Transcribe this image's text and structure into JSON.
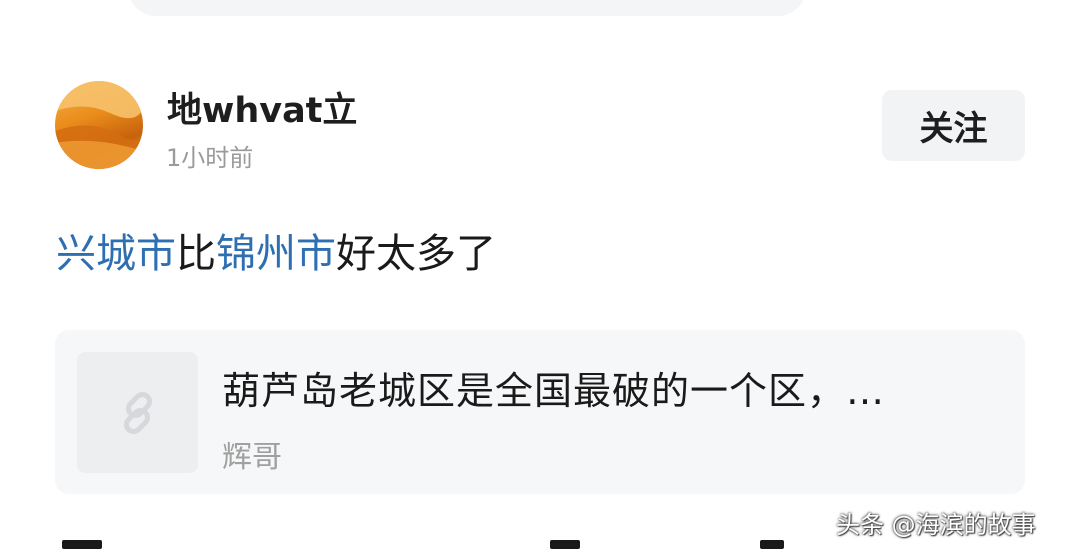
{
  "post": {
    "author": {
      "name": "地whvat立",
      "time": "1小时前"
    },
    "follow_label": "关注",
    "comment": {
      "parts": [
        {
          "text": "兴城市",
          "link": true
        },
        {
          "text": "比",
          "link": false
        },
        {
          "text": "锦州市",
          "link": true
        },
        {
          "text": "好太多了",
          "link": false
        }
      ]
    },
    "shared_card": {
      "title": "葫芦岛老城区是全国最破的一个区，…",
      "author": "辉哥",
      "thumb_icon": "link-icon"
    }
  },
  "watermark": "头条 @海滨的故事",
  "colors": {
    "link": "#2e6fb2",
    "follow_bg": "#f2f3f5",
    "card_bg": "#f6f7f8",
    "muted_text": "#9a9a9a"
  }
}
